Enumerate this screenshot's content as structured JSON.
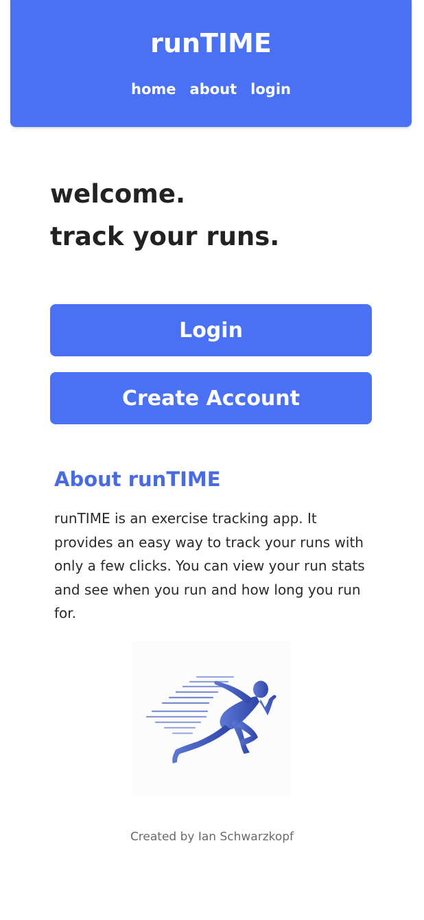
{
  "header": {
    "title": "runTIME",
    "nav": [
      {
        "label": "home"
      },
      {
        "label": "about"
      },
      {
        "label": "login"
      }
    ]
  },
  "hero": {
    "line1": "welcome.",
    "line2": "track your runs."
  },
  "actions": {
    "login_label": "Login",
    "create_label": "Create Account"
  },
  "about": {
    "title": "About runTIME",
    "body": "runTIME is an exercise tracking app. It provides an easy way to track your runs with only a few clicks. You can view your run stats and see when you run and how long you run for."
  },
  "image": {
    "icon": "running-man-icon"
  },
  "footer": {
    "credit": "Created by Ian Schwarzkopf"
  },
  "colors": {
    "brand": "#4a70f4",
    "about_title": "#4a6be0",
    "runner": "#3d55b8"
  }
}
